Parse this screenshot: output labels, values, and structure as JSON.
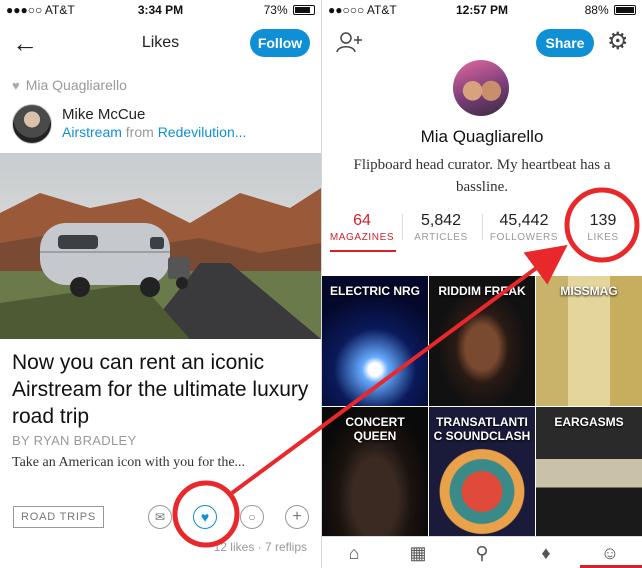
{
  "left": {
    "status": {
      "carrier": "●●●○○ AT&T",
      "time": "3:34 PM",
      "battery": "73%",
      "battery_fill": 0.73
    },
    "header": {
      "title": "Likes",
      "follow_label": "Follow"
    },
    "liked_by": "Mia Quagliarello",
    "author": {
      "name": "Mike McCue",
      "source_magazine": "Airstream",
      "from_word": "from",
      "source_user": "Redevilution..."
    },
    "article": {
      "headline": "Now you can rent an iconic Airstream for the ultimate luxury road trip",
      "byline": "BY RYAN BRADLEY",
      "excerpt": "Take an American icon with you for the..."
    },
    "tag": "ROAD TRIPS",
    "stats_line": "12 likes · 7 reflips",
    "icons": [
      "back-arrow-icon",
      "heart-icon",
      "mail-icon",
      "like-heart-icon",
      "comment-icon",
      "plus-icon"
    ]
  },
  "right": {
    "status": {
      "carrier": "●●○○○ AT&T",
      "time": "12:57 PM",
      "battery": "88%",
      "battery_fill": 0.88
    },
    "header": {
      "share_label": "Share"
    },
    "profile": {
      "name": "Mia Quagliarello",
      "bio": "Flipboard head curator. My heartbeat has a bassline."
    },
    "stats": [
      {
        "value": "64",
        "label": "MAGAZINES"
      },
      {
        "value": "5,842",
        "label": "ARTICLES"
      },
      {
        "value": "45,442",
        "label": "FOLLOWERS"
      },
      {
        "value": "139",
        "label": "LIKES"
      }
    ],
    "magazines": [
      "ELECTRIC NRG",
      "RIDDIM FREAK",
      "MISSMAG",
      "CONCERT QUEEN",
      "TRANSATLANTI C SOUNDCLASH",
      "EARGASMS"
    ],
    "tabs": [
      "home-icon",
      "grid-icon",
      "search-icon",
      "bell-icon",
      "profile-icon"
    ]
  },
  "colors": {
    "accent": "#0f8fd4",
    "highlight": "#d2232a",
    "annotation": "#e8282b"
  }
}
